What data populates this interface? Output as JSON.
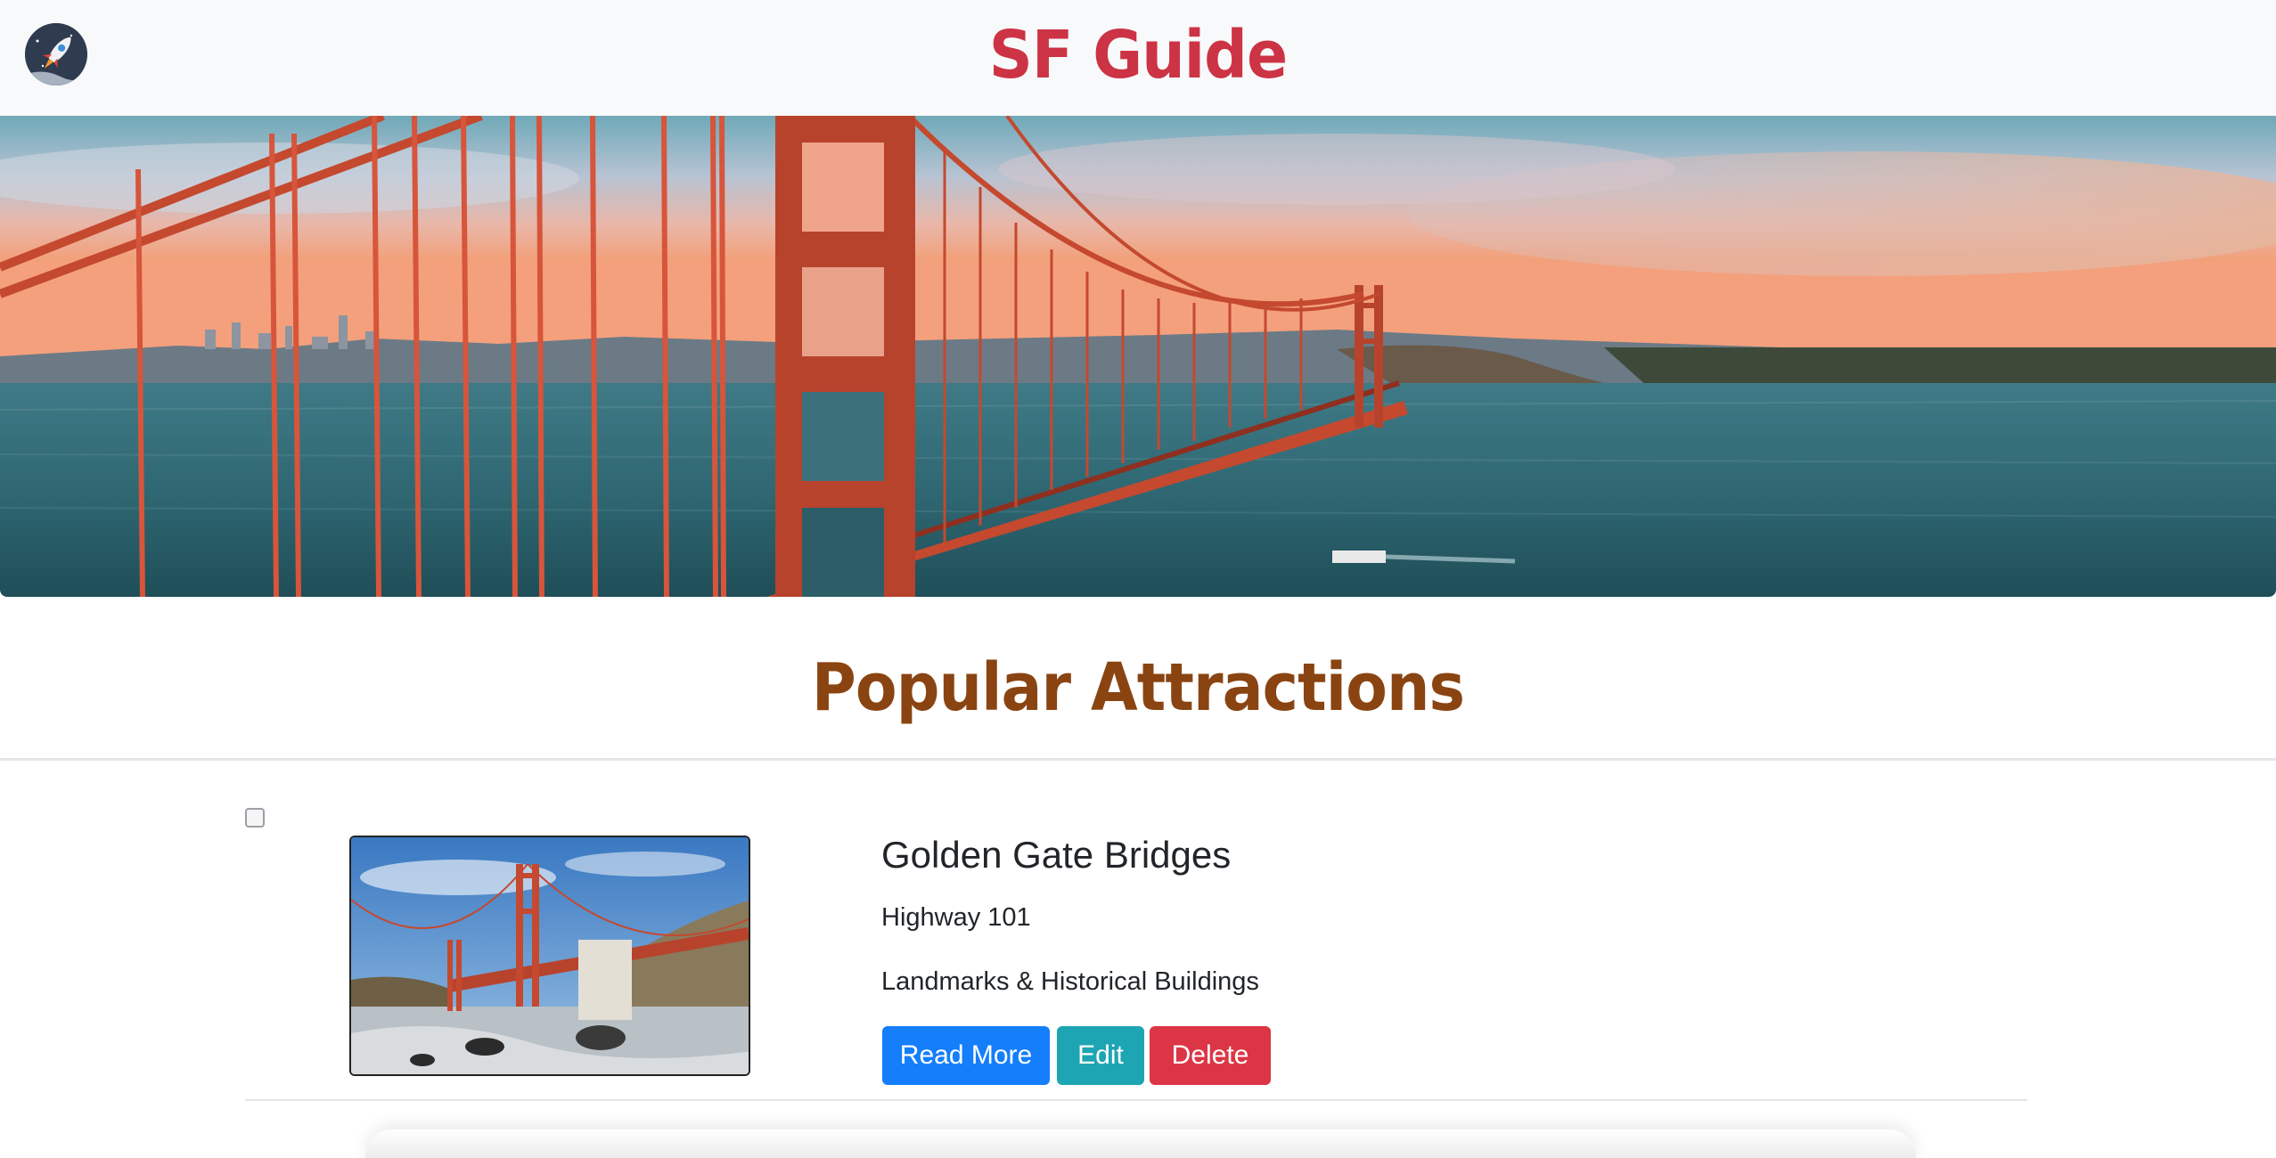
{
  "header": {
    "brand": "SF Guide",
    "logo_icon": "rocket-icon"
  },
  "hero": {
    "image": "golden-gate-bridge-panorama"
  },
  "section": {
    "title": "Popular Attractions"
  },
  "attractions": [
    {
      "selected": false,
      "image": "golden-gate-bridge-photo",
      "title": "Golden Gate Bridges",
      "address": "Highway 101",
      "category": "Landmarks & Historical Buildings",
      "buttons": {
        "read_more": "Read More",
        "edit": "Edit",
        "delete": "Delete"
      }
    }
  ],
  "colors": {
    "brand": "#cc3344",
    "section_title": "#8a4412",
    "primary": "#147efb",
    "info": "#1ea5b3",
    "danger": "#dc3545"
  }
}
